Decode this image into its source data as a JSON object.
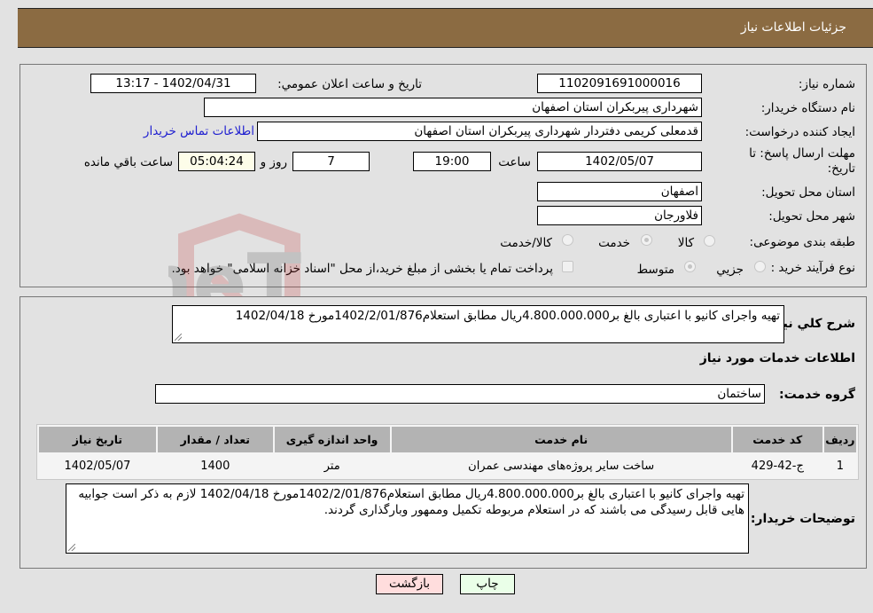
{
  "header": {
    "title": "جزئیات اطلاعات نیاز"
  },
  "details": {
    "need_number_label": "شماره نیاز:",
    "need_number": "1102091691000016",
    "announce_label": "تاریخ و ساعت اعلان عمومي:",
    "announce_value": "1402/04/31 - 13:17",
    "buyer_org_label": "نام دستگاه خریدار:",
    "buyer_org": "شهرداری پیربکران استان اصفهان",
    "requester_label": "ایجاد کننده درخواست:",
    "requester": "قدمعلی کریمی دفتردار شهرداری پیربکران استان اصفهان",
    "buyer_contact_link": "اطلاعات تماس خریدار",
    "deadline_label": "مهلت ارسال پاسخ: تا تاریخ:",
    "deadline_date": "1402/05/07",
    "time_label": "ساعت",
    "deadline_time": "19:00",
    "days_value": "7",
    "days_label": "روز و",
    "remaining_time": "05:04:24",
    "remaining_label": "ساعت باقي مانده",
    "province_label": "استان محل تحویل:",
    "province": "اصفهان",
    "city_label": "شهر محل تحویل:",
    "city": "فلاورجان",
    "category_label": "طبقه بندی موضوعی:",
    "category_options": [
      {
        "label": "کالا",
        "checked": false
      },
      {
        "label": "خدمت",
        "checked": true
      },
      {
        "label": "کالا/خدمت",
        "checked": false
      }
    ],
    "process_label": "نوع فرآیند خرید :",
    "process_options": [
      {
        "label": "جزيي",
        "checked": false
      },
      {
        "label": "متوسط",
        "checked": true
      }
    ],
    "treasury_checkbox_label": "پرداخت تمام یا بخشی از مبلغ خرید،از محل \"اسناد خزانه اسلامی\" خواهد بود.",
    "treasury_checked": false
  },
  "summary": {
    "label": "شرح كلي نياز:",
    "text": "تهیه واجرای کانیو با اعتباری بالغ بر4.800.000.000ریال مطابق استعلام1402/2/01/876مورخ 1402/04/18"
  },
  "services": {
    "section_title": "اطلاعات خدمات مورد نیاز",
    "group_label": "گروه خدمت:",
    "group_value": "ساختمان",
    "columns": [
      "ردیف",
      "کد خدمت",
      "نام خدمت",
      "واحد اندازه گیری",
      "تعداد / مقدار",
      "تاریخ نیاز"
    ],
    "rows": [
      [
        "1",
        "ج-42-429",
        "ساخت سایر پروژه‌های مهندسی عمران",
        "متر",
        "1400",
        "1402/05/07"
      ]
    ]
  },
  "buyer_notes": {
    "label": "توضیحات خریدار:",
    "text": "تهیه واجرای کانیو با اعتباری بالغ بر4.800.000.000ریال مطابق استعلام1402/2/01/876مورخ 1402/04/18 لازم به ذکر است جوابیه هایی قابل رسیدگی می باشند که در استعلام مربوطه تکمیل وممهور وبارگذاری گردند."
  },
  "buttons": {
    "print": "چاپ",
    "back": "بازگشت"
  },
  "watermark": {
    "text": "AriaTender.neT",
    "colors": {
      "shield": "#c23030",
      "text": "#555555"
    }
  }
}
